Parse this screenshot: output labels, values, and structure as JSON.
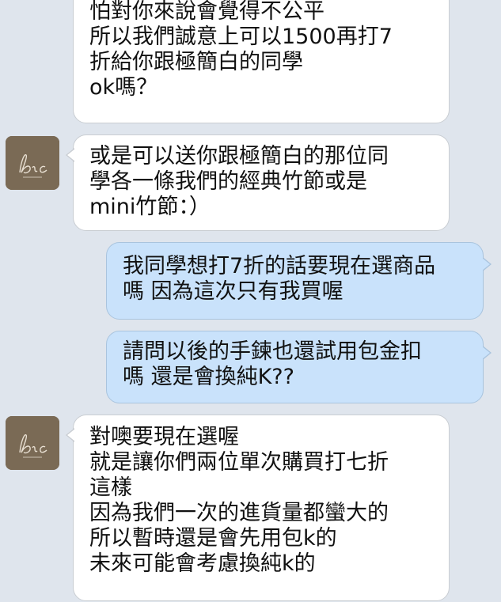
{
  "messages": [
    {
      "sender": "shop",
      "lines": [
        "怕對你來說會覺得不公平",
        "所以我們誠意上可以1500再打7",
        "折給你跟極簡白的同學",
        "ok嗎？"
      ]
    },
    {
      "sender": "shop",
      "lines": [
        "或是可以送你跟極簡白的那位同",
        "學各一條我們的經典竹節或是",
        "mini竹節：）"
      ]
    },
    {
      "sender": "me",
      "lines": [
        "我同學想打7折的話要現在選商品",
        "嗎 因為這次只有我買喔"
      ]
    },
    {
      "sender": "me",
      "lines": [
        "請問以後的手鍊也還試用包金扣",
        "嗎 還是會換純K??"
      ]
    },
    {
      "sender": "shop",
      "lines": [
        "對噢要現在選喔",
        "就是讓你們兩位單次購買打七折",
        "這樣",
        "因為我們一次的進貨量都蠻大的",
        "所以暫時還是會先用包k的",
        "未來可能會考慮換純k的"
      ]
    }
  ],
  "avatar_logo_text": "bic"
}
